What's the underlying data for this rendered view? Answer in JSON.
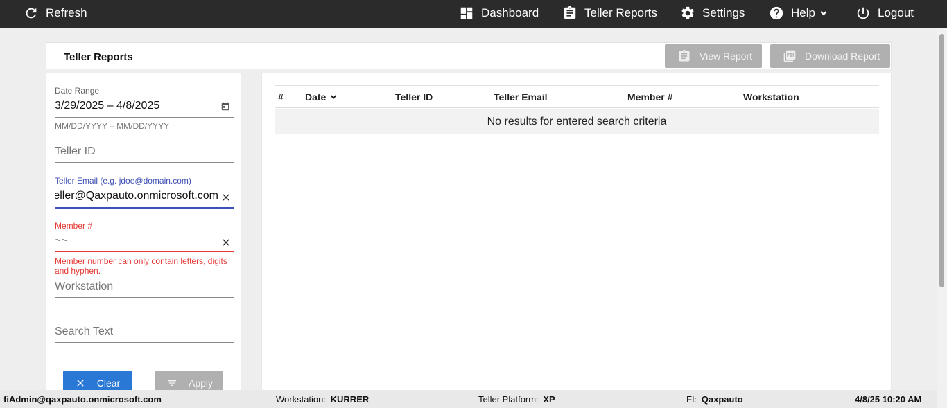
{
  "nav": {
    "refresh": "Refresh",
    "dashboard": "Dashboard",
    "teller_reports": "Teller Reports",
    "settings": "Settings",
    "help": "Help",
    "logout": "Logout"
  },
  "header": {
    "title": "Teller Reports",
    "view_report": "View Report",
    "download_report": "Download Report"
  },
  "filters": {
    "date_range": {
      "label": "Date Range",
      "value": "3/29/2025 – 4/8/2025",
      "hint": "MM/DD/YYYY – MM/DD/YYYY"
    },
    "teller_id": {
      "placeholder": "Teller ID"
    },
    "teller_email": {
      "label": "Teller Email (e.g. jdoe@domain.com)",
      "value": "eller@Qaxpauto.onmicrosoft.com"
    },
    "member": {
      "label": "Member #",
      "value": "~~",
      "error": "Member number can only contain letters, digits and hyphen."
    },
    "workstation": {
      "placeholder": "Workstation"
    },
    "search_text": {
      "placeholder": "Search Text"
    },
    "clear_label": "Clear",
    "apply_label": "Apply"
  },
  "table": {
    "columns": [
      "#",
      "Date",
      "Teller ID",
      "Teller Email",
      "Member #",
      "Workstation"
    ],
    "empty_message": "No results for entered search criteria"
  },
  "footer": {
    "user": "fiAdmin@qaxpauto.onmicrosoft.com",
    "workstation_label": "Workstation:",
    "workstation_value": "KURRER",
    "platform_label": "Teller Platform:",
    "platform_value": "XP",
    "fi_label": "FI:",
    "fi_value": "Qaxpauto",
    "datetime": "4/8/25 10:20 AM"
  }
}
